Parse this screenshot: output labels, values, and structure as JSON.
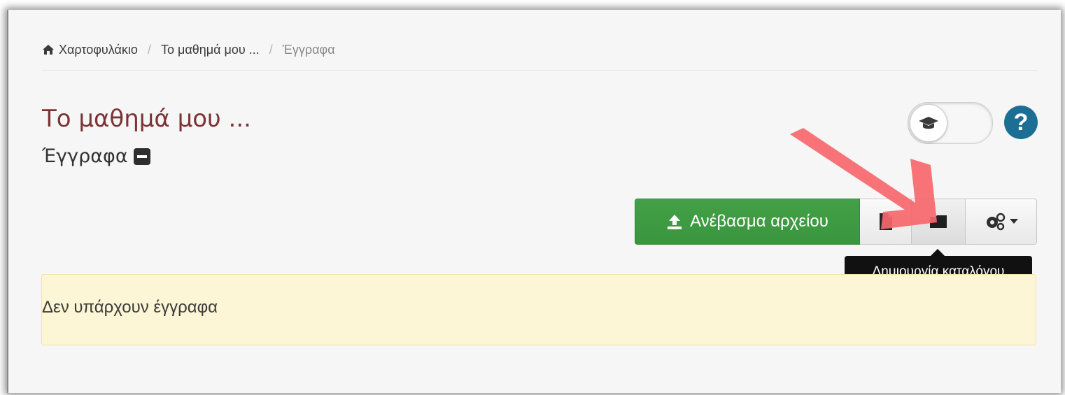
{
  "breadcrumb": {
    "home_icon": "home-icon",
    "items": [
      "Χαρτοφυλάκιο",
      "Το μαθημά μου ...",
      "Έγγραφα"
    ],
    "separator": "/"
  },
  "header": {
    "title": "Το μαθημά μου ...",
    "subtitle": "Έγγραφα",
    "subtitle_icon": "minus-square-icon"
  },
  "toggle": {
    "icon": "graduation-cap-icon"
  },
  "help": {
    "label": "?",
    "color": "#1d6e95"
  },
  "toolbar": {
    "upload_label": "Ανέβασμα αρχείου",
    "upload_icon": "upload-icon",
    "upload_color": "#3d9a40",
    "file_icon": "file-icon",
    "folder_icon": "folder-icon",
    "settings_icon": "gears-icon",
    "dropdown_icon": "caret-down-icon"
  },
  "tooltip": {
    "text": "Δημιουργία καταλόγου"
  },
  "alert": {
    "text": "Δεν υπάρχουν έγγραφα",
    "background": "#fcf6d6"
  },
  "annotation": {
    "color": "#f6676b"
  }
}
